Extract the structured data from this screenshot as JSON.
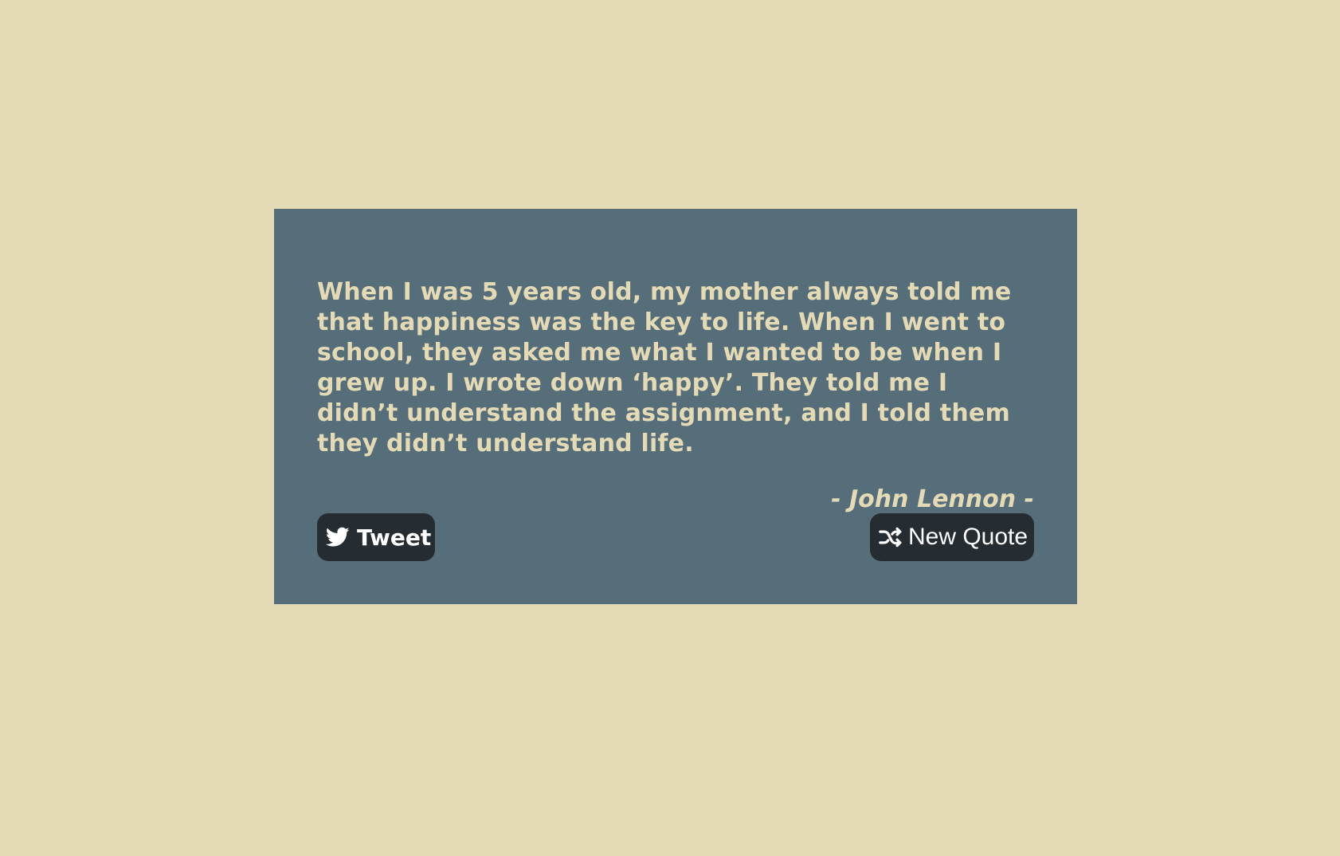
{
  "page": {
    "background_color": "#e5dab6"
  },
  "quote_box": {
    "background_color": "#566d7a",
    "text_color": "#e5dab6",
    "text": "When I was 5 years old, my mother always told me that happiness was the key to life. When I went to school, they asked me what I wanted to be when I grew up. I wrote down ‘happy’. They told me I didn’t understand the assignment, and I told them they didn’t understand life.",
    "author": "- John Lennon -"
  },
  "buttons": {
    "background_color": "#252d33",
    "tweet": {
      "label": "Tweet",
      "icon": "twitter-icon"
    },
    "new_quote": {
      "label": "New Quote",
      "icon": "shuffle-icon"
    }
  }
}
